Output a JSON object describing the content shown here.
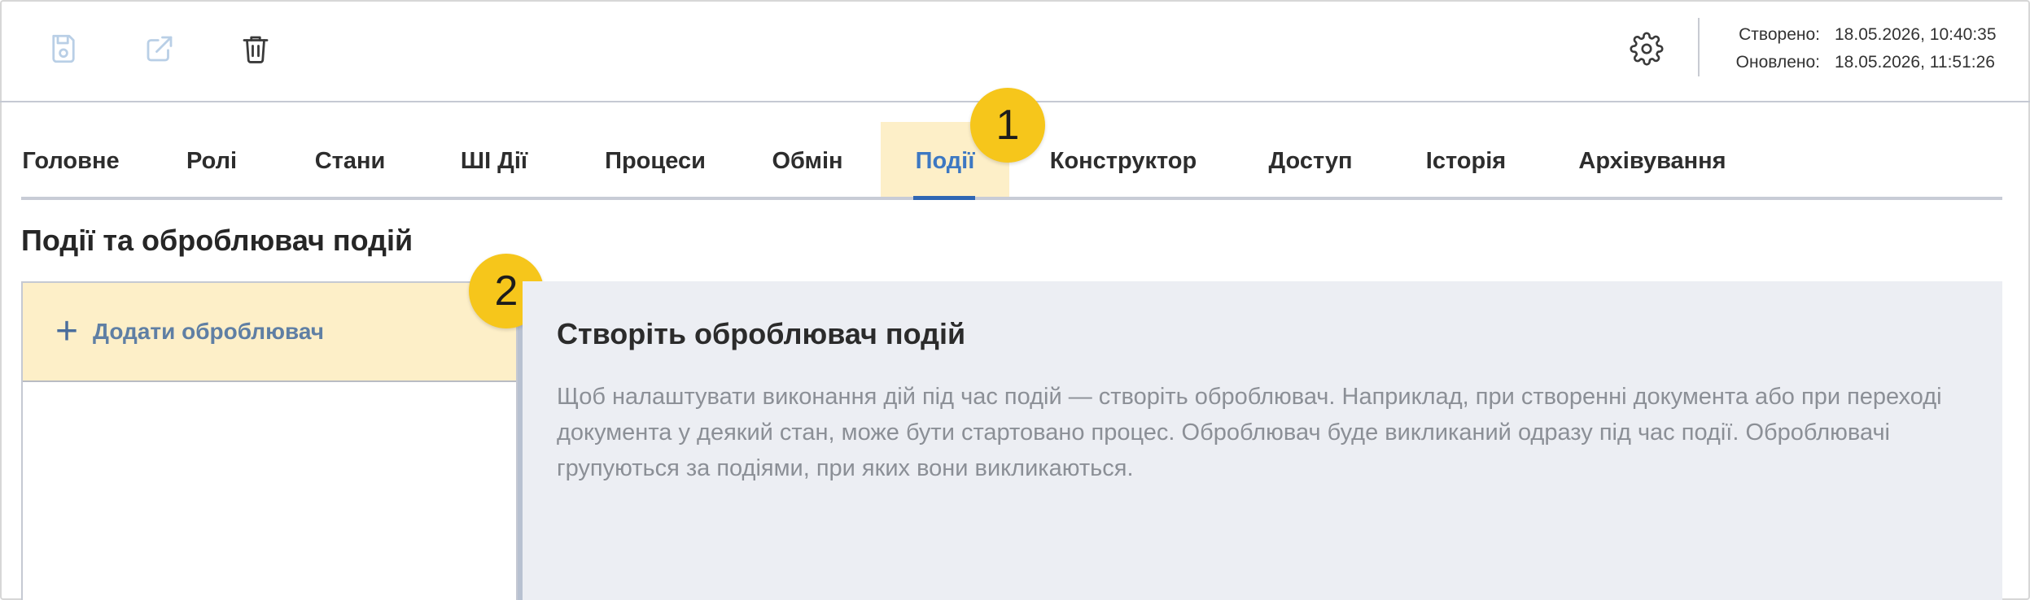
{
  "toolbar": {
    "save_icon": "save-icon",
    "open_external_icon": "open-external-icon",
    "delete_icon": "trash-icon",
    "settings_icon": "gear-icon",
    "created_label": "Створено:",
    "created_value": "18.05.2026, 10:40:35",
    "updated_label": "Оновлено:",
    "updated_value": "18.05.2026, 11:51:26"
  },
  "tabs": [
    {
      "label": "Головне"
    },
    {
      "label": "Ролі"
    },
    {
      "label": "Стани"
    },
    {
      "label": "ШІ Дії"
    },
    {
      "label": "Процеси"
    },
    {
      "label": "Обмін"
    },
    {
      "label": "Події",
      "active": true
    },
    {
      "label": "Конструктор"
    },
    {
      "label": "Доступ"
    },
    {
      "label": "Історія"
    },
    {
      "label": "Архівування"
    }
  ],
  "callouts": {
    "one": "1",
    "two": "2"
  },
  "colors": {
    "accent": "#2f66b3",
    "highlight": "#fdefc8",
    "callout": "#f6c61b"
  },
  "section": {
    "title": "Події та оброблювач подій"
  },
  "left_panel": {
    "add_label": "Додати оброблювач",
    "add_icon": "plus-icon"
  },
  "right_panel": {
    "title": "Створіть оброблювач подій",
    "description": "Щоб налаштувати виконання дій під час подій — створіть оброблювач. Наприклад, при створенні документа або при переході документа у деякий стан, може бути стартовано процес. Оброблювач буде викликаний одразу під час події. Оброблювачі групуються за подіями, при яких вони викликаються."
  }
}
